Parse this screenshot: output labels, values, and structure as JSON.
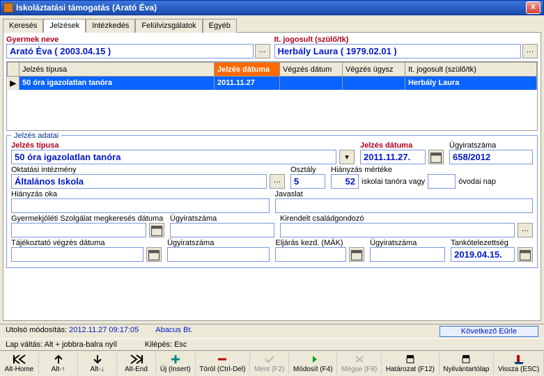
{
  "window": {
    "title": "Iskoláztatási támogatás (Arató Éva)"
  },
  "tabs": {
    "items": [
      "Keresés",
      "Jelzések",
      "Intézkedés",
      "Felülvizsgálatok",
      "Egyéb"
    ],
    "active": 1
  },
  "header": {
    "child_label": "Gyermek neve",
    "child_value": "Arató Éva ( 2003.04.15 )",
    "guardian_label": "It. jogosult (szülő/tk)",
    "guardian_value": "Herbály Laura ( 1979.02.01 )"
  },
  "table": {
    "cols": [
      "Jelzés típusa",
      "Jelzés dátuma",
      "Végzés dátum",
      "Végzés ügysz",
      "It. jogosult (szülő/tk)"
    ],
    "row": {
      "type": "50 óra igazolatlan tanóra",
      "date": "2011.11.27",
      "vdate": "",
      "vugsz": "",
      "guardian": "Herbály Laura"
    }
  },
  "details": {
    "legend": "Jelzés adatai",
    "type_label": "Jelzés típusa",
    "type_value": "50 óra igazolatlan tanóra",
    "date_label": "Jelzés dátuma",
    "date_value": "2011.11.27.",
    "caseno_label": "Ügyiratszáma",
    "caseno_value": "658/2012",
    "school_label": "Oktatási intézmény",
    "school_value": "Általános Iskola",
    "class_label": "Osztály",
    "class_value": "5",
    "absence_amount_label": "Hiányzás mértéke",
    "absence_lessons": "52",
    "absence_lessons_suffix": "iskolai tanóra vagy",
    "absence_days": "",
    "absence_days_suffix": "óvodai nap",
    "absence_reason_label": "Hiányzás oka",
    "absence_reason": "",
    "proposal_label": "Javaslat",
    "proposal": "",
    "gysz_label": "Gyermekjóléti Szolgálat megkeresés dátuma",
    "gysz_date": "",
    "gysz_caseno_label": "Ügyiratszáma",
    "gysz_caseno": "",
    "kirendelt_label": "Kirendelt családgondozó",
    "kirendelt": "",
    "taj_label": "Tájékoztató végzés dátuma",
    "taj_date": "",
    "taj_caseno_label": "Ügyiratszáma",
    "taj_caseno": "",
    "mak_label": "Eljárás kezd. (MÁK)",
    "mak_date": "",
    "mak_caseno_label": "Ügyiratszáma",
    "mak_caseno": "",
    "tankot_label": "Tankötelezettség",
    "tankot_value": "2019.04.15."
  },
  "status": {
    "mod_label": "Utolsó módosítás:",
    "mod_value": "2012.11.27 09:17:05",
    "company": "Abacus Bt.",
    "next_btn": "Következő Eűrle"
  },
  "hints": {
    "lap": "Lap váltás: Alt + jobbra-balra nyíl",
    "kilepes": "Kilépés: Esc"
  },
  "toolbar": {
    "althome": "Alt-Home",
    "altup": "Alt-↑",
    "altdown": "Alt-↓",
    "altend": "Alt-End",
    "uj": "Új (Insert)",
    "torol": "Töröl (Ctrl-Del)",
    "ment": "Ment (F2)",
    "modosit": "Módosít (F4)",
    "megse": "Mégse (F8)",
    "hatarozat": "Határozat (F12)",
    "nyilv": "Nyilvántartólap",
    "vissza": "Vissza (ESC)"
  }
}
